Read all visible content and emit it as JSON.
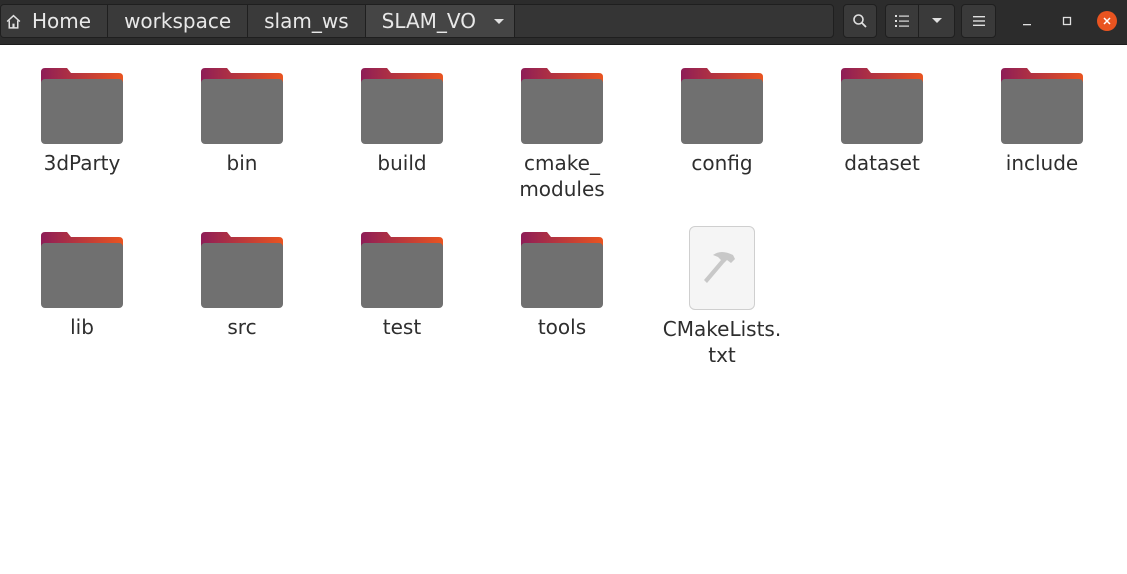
{
  "breadcrumb": [
    "Home",
    "workspace",
    "slam_ws",
    "SLAM_VO"
  ],
  "toolbar": {
    "search_icon": "search-icon",
    "view_icon": "list-view-icon",
    "menu_icon": "hamburger-menu-icon"
  },
  "window": {
    "close_color": "#e95420"
  },
  "files": [
    {
      "name": "3dParty",
      "type": "folder"
    },
    {
      "name": "bin",
      "type": "folder"
    },
    {
      "name": "build",
      "type": "folder"
    },
    {
      "name": "cmake_\nmodules",
      "type": "folder"
    },
    {
      "name": "config",
      "type": "folder"
    },
    {
      "name": "dataset",
      "type": "folder"
    },
    {
      "name": "include",
      "type": "folder"
    },
    {
      "name": "lib",
      "type": "folder"
    },
    {
      "name": "src",
      "type": "folder"
    },
    {
      "name": "test",
      "type": "folder"
    },
    {
      "name": "tools",
      "type": "folder"
    },
    {
      "name": "CMakeLists.\ntxt",
      "type": "text"
    }
  ],
  "colors": {
    "folder_body": "#707070",
    "folder_tab_from": "#8e1d57",
    "folder_tab_to": "#e95420"
  }
}
